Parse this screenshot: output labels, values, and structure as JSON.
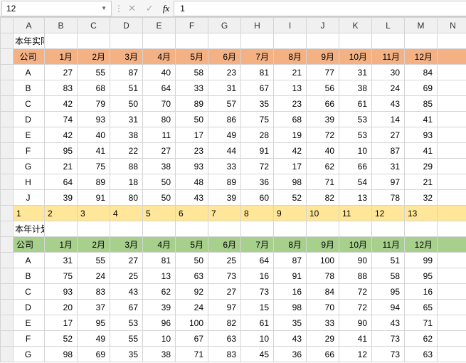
{
  "formula_bar": {
    "name_box": "12",
    "cancel": "✕",
    "confirm": "✓",
    "fx": "fx",
    "value": "1"
  },
  "col_headers": [
    "",
    "A",
    "B",
    "C",
    "D",
    "E",
    "F",
    "G",
    "H",
    "I",
    "J",
    "K",
    "L",
    "M",
    "N"
  ],
  "section1": {
    "title": "本年实际",
    "headers": [
      "公司",
      "1月",
      "2月",
      "3月",
      "4月",
      "5月",
      "6月",
      "7月",
      "8月",
      "9月",
      "10月",
      "11月",
      "12月"
    ]
  },
  "section2": {
    "title": "本年计划",
    "headers": [
      "公司",
      "1月",
      "2月",
      "3月",
      "4月",
      "5月",
      "6月",
      "7月",
      "8月",
      "9月",
      "10月",
      "11月",
      "12月"
    ]
  },
  "yellow_row": [
    "1",
    "2",
    "3",
    "4",
    "5",
    "6",
    "7",
    "8",
    "9",
    "10",
    "11",
    "12",
    "13"
  ],
  "chart_data": [
    {
      "type": "table",
      "title": "本年实际",
      "categories": [
        "1月",
        "2月",
        "3月",
        "4月",
        "5月",
        "6月",
        "7月",
        "8月",
        "9月",
        "10月",
        "11月",
        "12月"
      ],
      "series": [
        {
          "name": "A",
          "values": [
            27,
            55,
            87,
            40,
            58,
            23,
            81,
            21,
            77,
            31,
            30,
            84
          ]
        },
        {
          "name": "B",
          "values": [
            83,
            68,
            51,
            64,
            33,
            31,
            67,
            13,
            56,
            38,
            24,
            69
          ]
        },
        {
          "name": "C",
          "values": [
            42,
            79,
            50,
            70,
            89,
            57,
            35,
            23,
            66,
            61,
            43,
            85
          ]
        },
        {
          "name": "D",
          "values": [
            74,
            93,
            31,
            80,
            50,
            86,
            75,
            68,
            39,
            53,
            14,
            41
          ]
        },
        {
          "name": "E",
          "values": [
            42,
            40,
            38,
            11,
            17,
            49,
            28,
            19,
            72,
            53,
            27,
            93
          ]
        },
        {
          "name": "F",
          "values": [
            95,
            41,
            22,
            27,
            23,
            44,
            91,
            42,
            40,
            10,
            87,
            41
          ]
        },
        {
          "name": "G",
          "values": [
            21,
            75,
            88,
            38,
            93,
            33,
            72,
            17,
            62,
            66,
            31,
            29
          ]
        },
        {
          "name": "H",
          "values": [
            64,
            89,
            18,
            50,
            48,
            89,
            36,
            98,
            71,
            54,
            97,
            21
          ]
        },
        {
          "name": "J",
          "values": [
            39,
            91,
            80,
            50,
            43,
            39,
            60,
            52,
            82,
            13,
            78,
            32
          ]
        }
      ]
    },
    {
      "type": "table",
      "title": "本年计划",
      "categories": [
        "1月",
        "2月",
        "3月",
        "4月",
        "5月",
        "6月",
        "7月",
        "8月",
        "9月",
        "10月",
        "11月",
        "12月"
      ],
      "series": [
        {
          "name": "A",
          "values": [
            31,
            55,
            27,
            81,
            50,
            25,
            64,
            87,
            100,
            90,
            51,
            99
          ]
        },
        {
          "name": "B",
          "values": [
            75,
            24,
            25,
            13,
            63,
            73,
            16,
            91,
            78,
            88,
            58,
            95
          ]
        },
        {
          "name": "C",
          "values": [
            93,
            83,
            43,
            62,
            92,
            27,
            73,
            16,
            84,
            72,
            95,
            16
          ]
        },
        {
          "name": "D",
          "values": [
            20,
            37,
            67,
            39,
            24,
            97,
            15,
            98,
            70,
            72,
            94,
            65
          ]
        },
        {
          "name": "E",
          "values": [
            17,
            95,
            53,
            96,
            100,
            82,
            61,
            35,
            33,
            90,
            43,
            71
          ]
        },
        {
          "name": "F",
          "values": [
            52,
            49,
            55,
            10,
            67,
            63,
            10,
            43,
            29,
            41,
            73,
            62
          ]
        },
        {
          "name": "G",
          "values": [
            98,
            69,
            35,
            38,
            71,
            83,
            45,
            36,
            66,
            12,
            73,
            63
          ]
        }
      ]
    }
  ],
  "row_headers_visible": [
    "",
    "",
    "",
    "",
    "",
    "",
    "",
    "",
    "",
    "",
    "",
    "",
    "",
    "",
    "",
    "",
    "",
    "",
    "",
    "",
    ""
  ]
}
